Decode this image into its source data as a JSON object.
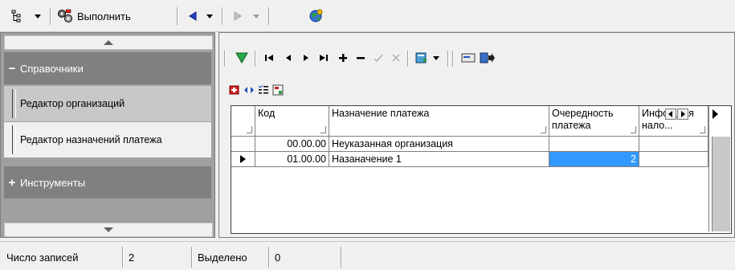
{
  "toolbar": {
    "execute_label": "Выполнить"
  },
  "nav": {
    "groups": [
      {
        "label": "Справочники",
        "expanded": true,
        "symbol": "−"
      },
      {
        "label": "Инструменты",
        "expanded": false,
        "symbol": "+"
      }
    ],
    "items": [
      {
        "label": "Редактор организаций"
      },
      {
        "label": "Редактор назначений платежа"
      }
    ]
  },
  "grid": {
    "columns": [
      {
        "label": "Код"
      },
      {
        "label": "Назначение платежа"
      },
      {
        "label": "Очередность платежа"
      },
      {
        "label": "Инфор для нало..."
      }
    ],
    "rows": [
      {
        "code": "00.00.00",
        "purpose": "Неуказанная организация",
        "priority": "",
        "info": "",
        "current": false
      },
      {
        "code": "01.00.00",
        "purpose": "Назаначение 1",
        "priority": "2",
        "info": "",
        "current": true
      }
    ],
    "selection_color": "#3399ff"
  },
  "status": {
    "records_label": "Число записей",
    "records_value": "2",
    "selected_label": "Выделено",
    "selected_value": "0"
  }
}
